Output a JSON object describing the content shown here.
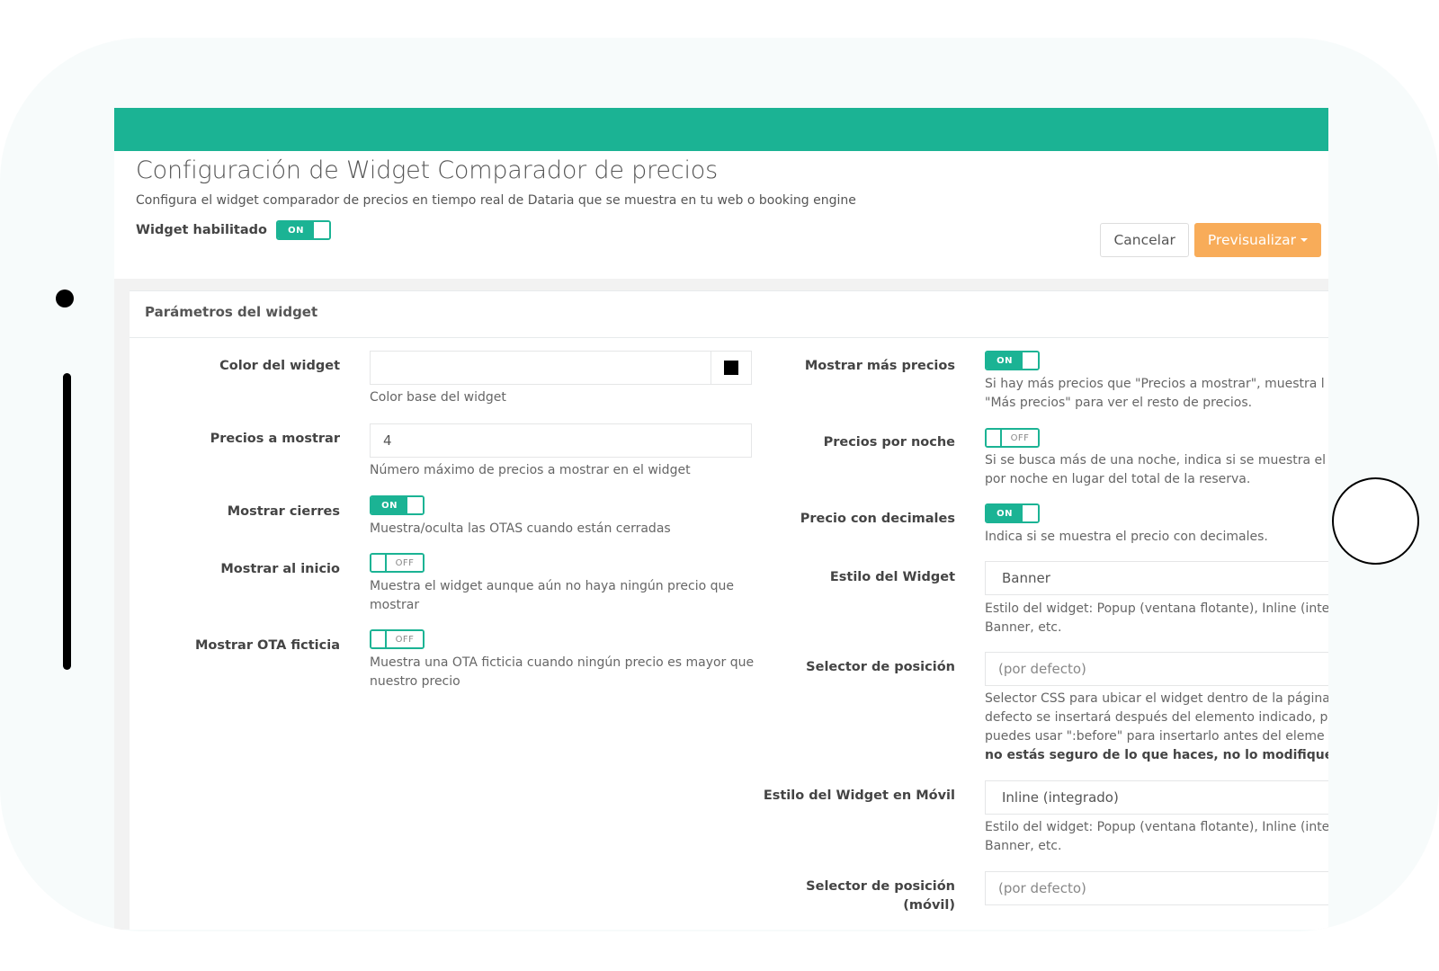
{
  "header": {
    "title": "Configuración de Widget Comparador de precios",
    "subtitle": "Configura el widget comparador de precios en tiempo real de Dataria que se muestra en tu web o booking engine",
    "enabled_label": "Widget habilitado",
    "enabled_toggle": "ON",
    "cancel_label": "Cancelar",
    "preview_label": "Previsualizar"
  },
  "panel": {
    "title": "Parámetros del widget"
  },
  "left": {
    "color": {
      "label": "Color del widget",
      "value": "",
      "help": "Color base del widget",
      "swatch_color": "#000000"
    },
    "prices": {
      "label": "Precios a mostrar",
      "value": "4",
      "help": "Número máximo de precios a mostrar en el widget"
    },
    "closures": {
      "label": "Mostrar cierres",
      "toggle": "ON",
      "help": "Muestra/oculta las OTAS cuando están cerradas"
    },
    "at_start": {
      "label": "Mostrar al inicio",
      "toggle": "OFF",
      "help_1": "Muestra el widget aunque aún no haya ningún precio que",
      "help_2": "mostrar"
    },
    "fake_ota": {
      "label": "Mostrar OTA ficticia",
      "toggle": "OFF",
      "help_1": "Muestra una OTA ficticia cuando ningún precio es mayor que",
      "help_2": "nuestro precio"
    }
  },
  "right": {
    "more_prices": {
      "label": "Mostrar más precios",
      "toggle": "ON",
      "help_1": "Si hay más precios que \"Precios a mostrar\", muestra l",
      "help_2": "\"Más precios\" para ver el resto de precios."
    },
    "per_night": {
      "label": "Precios por noche",
      "toggle": "OFF",
      "help_1": "Si se busca más de una noche, indica si se muestra el",
      "help_2": "por noche en lugar del total de la reserva."
    },
    "decimals": {
      "label": "Precio con decimales",
      "toggle": "ON",
      "help": "Indica si se muestra el precio con decimales."
    },
    "style": {
      "label": "Estilo del Widget",
      "value": "Banner",
      "help_1": "Estilo del widget: Popup (ventana flotante), Inline (inte",
      "help_2": "Banner, etc."
    },
    "position": {
      "label": "Selector de posición",
      "placeholder": "(por defecto)",
      "help_1": "Selector CSS para ubicar el widget dentro de la página",
      "help_2": "defecto se insertará después del elemento indicado, p",
      "help_3": "puedes usar \":before\" para insertarlo antes del eleme",
      "help_4": "no estás seguro de lo que haces, no lo modifiques"
    },
    "mobile_style": {
      "label": "Estilo del Widget en Móvil",
      "value": "Inline (integrado)",
      "help_1": "Estilo del widget: Popup (ventana flotante), Inline (inte",
      "help_2": "Banner, etc."
    },
    "mobile_position": {
      "label_1": "Selector de posición",
      "label_2": "(móvil)",
      "placeholder": "(por defecto)"
    }
  },
  "colors": {
    "accent": "#1bb394",
    "preview": "#f8ac59"
  }
}
